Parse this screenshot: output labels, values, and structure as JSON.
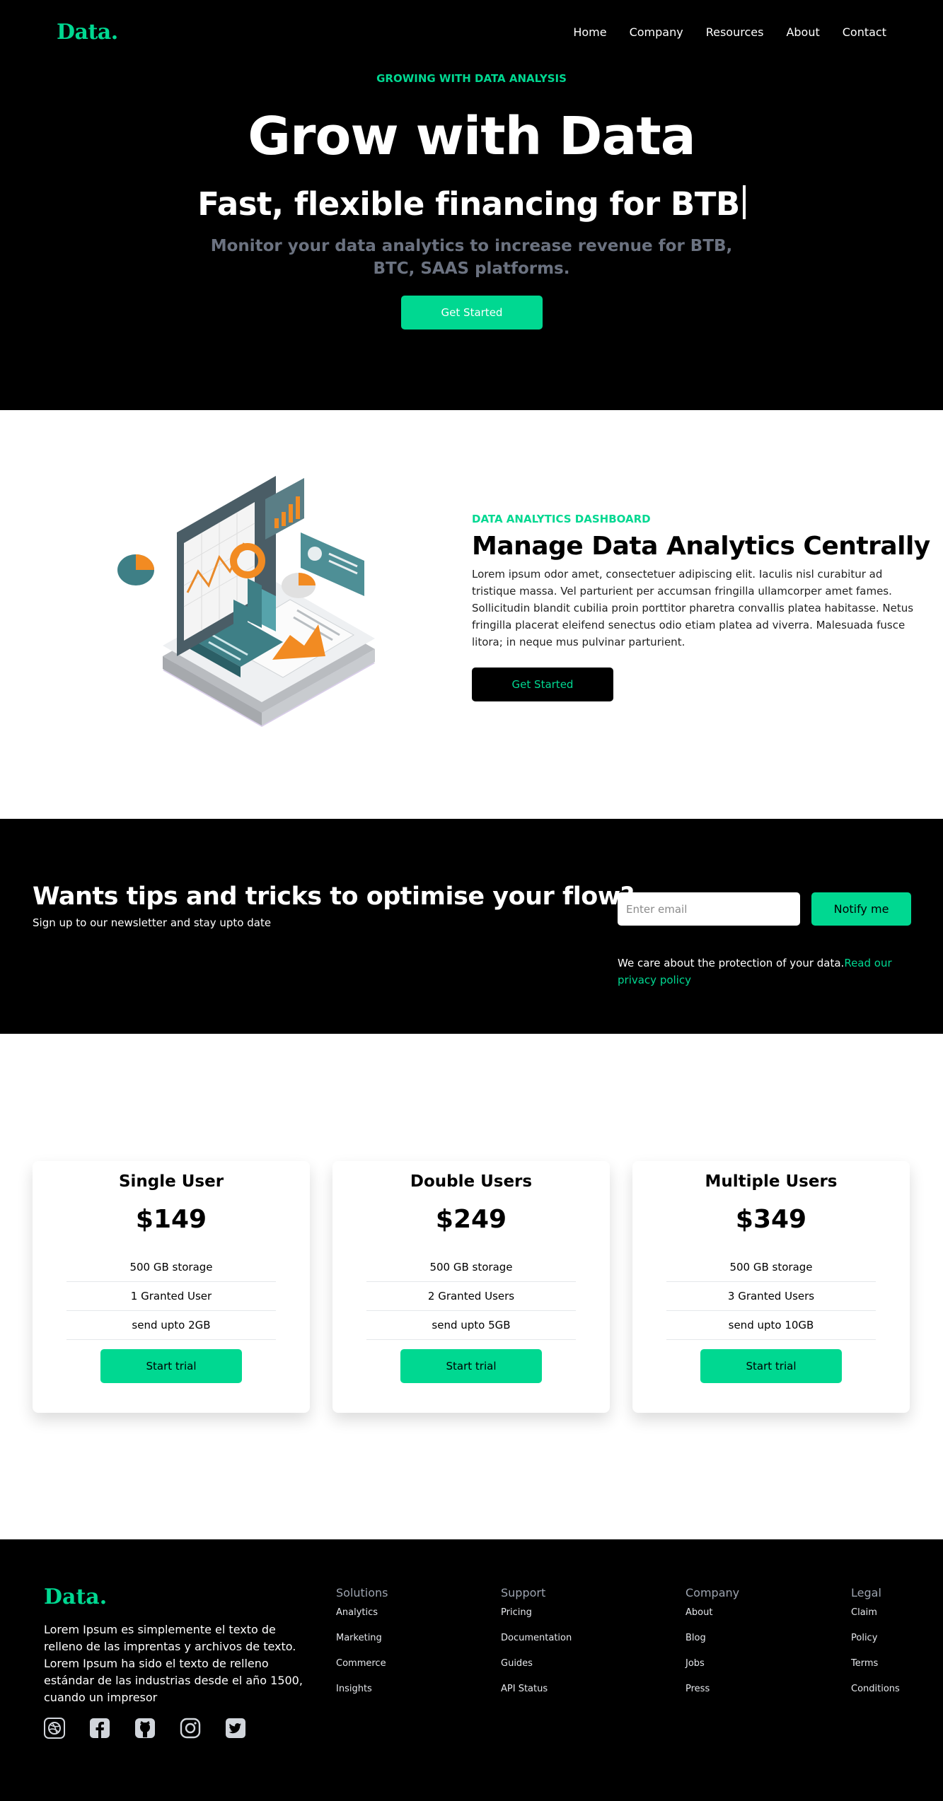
{
  "brand": {
    "logo": "Data.",
    "accent": "#00d891"
  },
  "nav": {
    "items": [
      "Home",
      "Company",
      "Resources",
      "About",
      "Contact"
    ]
  },
  "hero": {
    "eyebrow": "GROWING WITH DATA ANALYSIS",
    "title": "Grow with Data",
    "subtitle": "Fast, flexible financing for BTB",
    "description": "Monitor your data analytics to increase revenue for BTB, BTC, SAAS platforms.",
    "cta": "Get Started"
  },
  "analytics": {
    "eyebrow": "DATA ANALYTICS DASHBOARD",
    "title": "Manage Data Analytics Centrally",
    "body": "Lorem ipsum odor amet, consectetuer adipiscing elit. Iaculis nisl curabitur ad tristique massa. Vel parturient per accumsan fringilla ullamcorper amet fames. Sollicitudin blandit cubilia proin porttitor pharetra convallis platea habitasse. Netus fringilla placerat eleifend senectus odio etiam platea ad viverra. Malesuada fusce litora; in neque mus pulvinar parturient.",
    "cta": "Get Started"
  },
  "newsletter": {
    "title": "Wants tips and tricks to optimise your flow?",
    "subtitle": "Sign up to our newsletter and stay upto date",
    "email_placeholder": "Enter email",
    "button": "Notify me",
    "note": "We care about the protection of your data.",
    "note_link": "Read our privacy policy"
  },
  "pricing": {
    "plans": [
      {
        "name": "Single User",
        "price": "$149",
        "features": [
          "500 GB storage",
          "1 Granted User",
          "send upto 2GB"
        ],
        "cta": "Start trial"
      },
      {
        "name": "Double Users",
        "price": "$249",
        "features": [
          "500 GB storage",
          "2 Granted Users",
          "send upto 5GB"
        ],
        "cta": "Start trial"
      },
      {
        "name": "Multiple Users",
        "price": "$349",
        "features": [
          "500 GB storage",
          "3 Granted Users",
          "send upto 10GB"
        ],
        "cta": "Start trial"
      }
    ]
  },
  "footer": {
    "logo": "Data.",
    "description": "Lorem Ipsum es simplemente el texto de relleno de las imprentas y archivos de texto. Lorem Ipsum ha sido el texto de relleno estándar de las industrias desde el año 1500, cuando un impresor",
    "socials": [
      "dribbble-icon",
      "facebook-icon",
      "github-icon",
      "instagram-icon",
      "twitter-icon"
    ],
    "columns": [
      {
        "title": "Solutions",
        "links": [
          "Analytics",
          "Marketing",
          "Commerce",
          "Insights"
        ]
      },
      {
        "title": "Support",
        "links": [
          "Pricing",
          "Documentation",
          "Guides",
          "API Status"
        ]
      },
      {
        "title": "Company",
        "links": [
          "About",
          "Blog",
          "Jobs",
          "Press"
        ]
      },
      {
        "title": "Legal",
        "links": [
          "Claim",
          "Policy",
          "Terms",
          "Conditions"
        ]
      }
    ]
  }
}
